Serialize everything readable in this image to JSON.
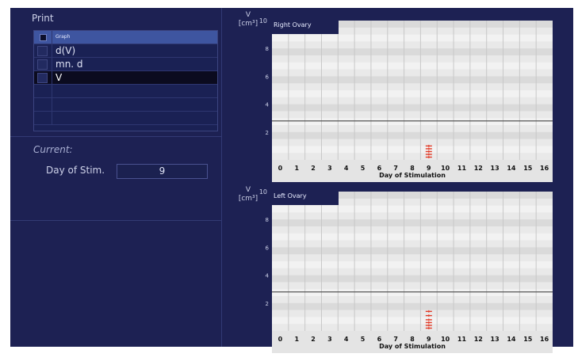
{
  "print_panel": {
    "title": "Print",
    "header_label": "Graph",
    "items": [
      {
        "label": "d(V)",
        "selected": false
      },
      {
        "label": "mn. d",
        "selected": false
      },
      {
        "label": "V",
        "selected": true
      }
    ]
  },
  "current": {
    "title": "Current:",
    "day_label": "Day of Stim.",
    "day_value": "9"
  },
  "colors": {
    "background": "#1d2153",
    "plot_area": "#e9e9e9",
    "threshold_line": "#555555",
    "marker": "#e23c28"
  },
  "chart_data": [
    {
      "type": "scatter",
      "title": "Right Ovary",
      "ylabel": "V",
      "yunit": "[cm³]",
      "xlabel": "Day of Stimulation",
      "ylim": [
        0,
        10
      ],
      "yticks": [
        2,
        4,
        6,
        8,
        10
      ],
      "xticks": [
        0,
        1,
        2,
        3,
        4,
        5,
        6,
        7,
        8,
        9,
        10,
        11,
        12,
        13,
        14,
        15,
        16
      ],
      "threshold": 2.8,
      "grid": true,
      "points": [
        {
          "x": 9,
          "y": 0.2
        },
        {
          "x": 9,
          "y": 0.4
        },
        {
          "x": 9,
          "y": 0.6
        },
        {
          "x": 9,
          "y": 0.8
        },
        {
          "x": 9,
          "y": 1.0
        }
      ]
    },
    {
      "type": "scatter",
      "title": "Left Ovary",
      "ylabel": "V",
      "yunit": "[cm³]",
      "xlabel": "Day of Stimulation",
      "ylim": [
        0,
        10
      ],
      "yticks": [
        2,
        4,
        6,
        8,
        10
      ],
      "xticks": [
        0,
        1,
        2,
        3,
        4,
        5,
        6,
        7,
        8,
        9,
        10,
        11,
        12,
        13,
        14,
        15,
        16
      ],
      "threshold": 2.8,
      "grid": true,
      "points": [
        {
          "x": 9,
          "y": 0.2
        },
        {
          "x": 9,
          "y": 0.4
        },
        {
          "x": 9,
          "y": 0.6
        },
        {
          "x": 9,
          "y": 0.8
        },
        {
          "x": 9,
          "y": 1.1
        },
        {
          "x": 9,
          "y": 1.4
        }
      ]
    }
  ]
}
